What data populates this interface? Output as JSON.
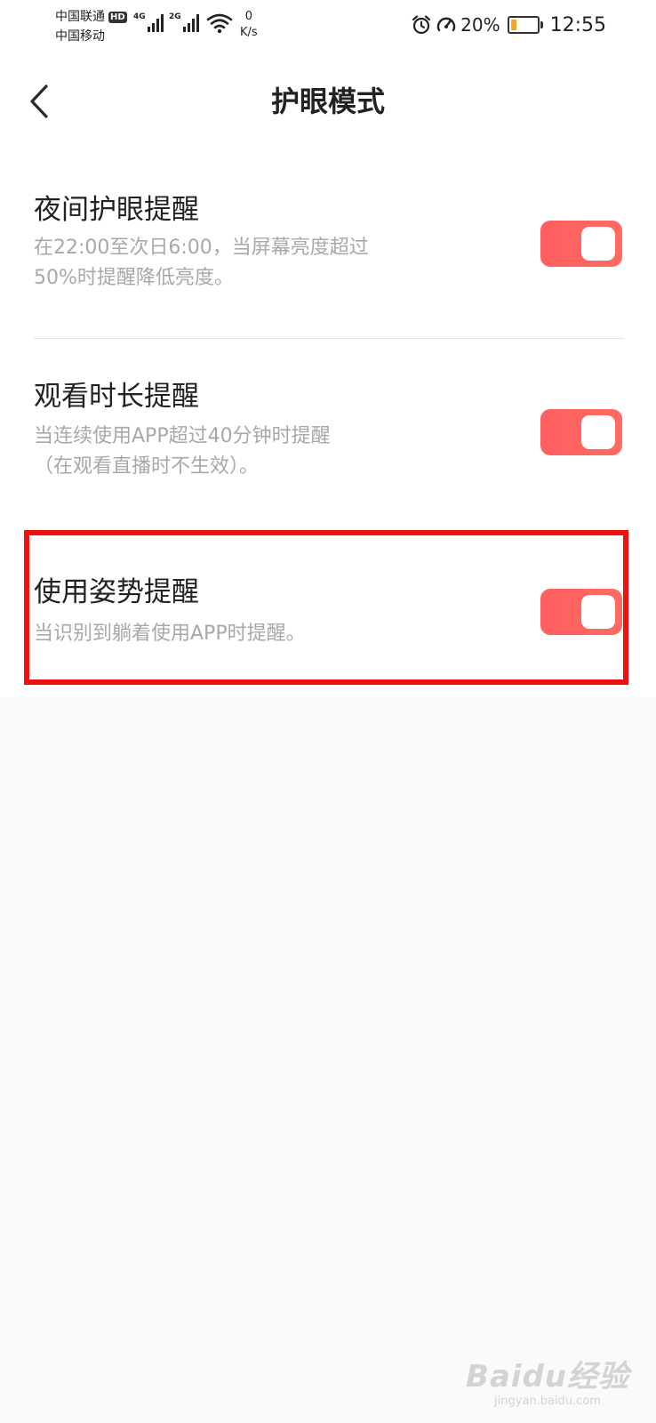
{
  "status_bar": {
    "carrier_1": "中国联通",
    "carrier_1_badge": "HD",
    "carrier_2": "中国移动",
    "network_1": "4G",
    "network_2": "2G",
    "net_speed_value": "0",
    "net_speed_unit": "K/s",
    "battery_percent": "20%",
    "battery_level": 0.2,
    "battery_color": "#f5a623",
    "time": "12:55",
    "icons": [
      "signal-icon",
      "wifi-icon",
      "alarm-icon",
      "speed-icon",
      "battery-icon"
    ]
  },
  "header": {
    "title": "护眼模式",
    "back_icon": "chevron-left-icon"
  },
  "settings": [
    {
      "title": "夜间护眼提醒",
      "desc_lines": [
        "在22:00至次日6:00，当屏幕亮度超过",
        "50%时提醒降低亮度。"
      ],
      "enabled": true
    },
    {
      "title": "观看时长提醒",
      "desc_lines": [
        "当连续使用APP超过40分钟时提醒",
        "（在观看直播时不生效）。"
      ],
      "enabled": true
    },
    {
      "title": "使用姿势提醒",
      "desc_lines": [
        "当识别到躺着使用APP时提醒。"
      ],
      "enabled": true
    }
  ],
  "colors": {
    "toggle_on": "#ff5f5f",
    "highlight": "#ee1111"
  },
  "watermark": {
    "logo": "Baidu经验",
    "url": "jingyan.baidu.com"
  }
}
